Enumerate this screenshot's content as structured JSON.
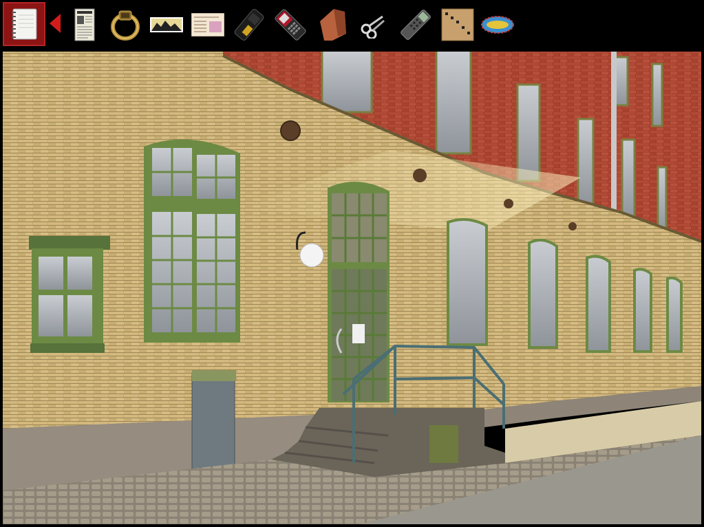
{
  "inventory": {
    "items": [
      {
        "id": "notebook",
        "icon": "notebook-icon",
        "selected": true
      },
      {
        "id": "back",
        "icon": "back-arrow-icon"
      },
      {
        "id": "newspaper",
        "icon": "newspaper-icon"
      },
      {
        "id": "ring",
        "icon": "gold-ring-icon"
      },
      {
        "id": "photo",
        "icon": "mountain-photo-icon"
      },
      {
        "id": "card",
        "icon": "id-card-icon"
      },
      {
        "id": "phone",
        "icon": "black-phone-icon"
      },
      {
        "id": "mobile",
        "icon": "red-mobile-phone-icon"
      },
      {
        "id": "brick",
        "icon": "brick-icon"
      },
      {
        "id": "scissors",
        "icon": "scissors-icon"
      },
      {
        "id": "remote",
        "icon": "remote-control-icon"
      },
      {
        "id": "cardboard",
        "icon": "cardboard-icon"
      },
      {
        "id": "badge",
        "icon": "oval-badge-icon"
      }
    ],
    "accent_color": "#8c1414"
  },
  "scene": {
    "description_icon": "brick-building-courtyard-scene"
  }
}
